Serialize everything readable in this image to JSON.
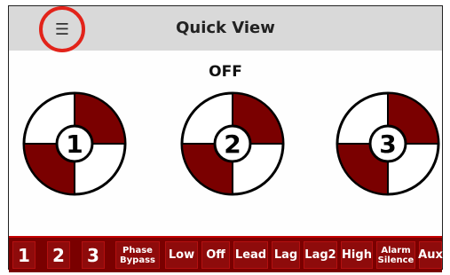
{
  "header": {
    "title": "Quick View",
    "menu_icon": "hamburger-icon"
  },
  "status": "OFF",
  "dials": [
    {
      "label": "1"
    },
    {
      "label": "2"
    },
    {
      "label": "3"
    }
  ],
  "bottom_bar": {
    "buttons": [
      "1",
      "2",
      "3",
      "Phase Bypass",
      "Low",
      "Off",
      "Lead",
      "Lag",
      "Lag2",
      "High",
      "Alarm Silence",
      "Aux"
    ]
  },
  "colors": {
    "accent": "#8e0b0b",
    "highlight_ring": "#e2231a",
    "header_bg": "#d9d9d9"
  }
}
